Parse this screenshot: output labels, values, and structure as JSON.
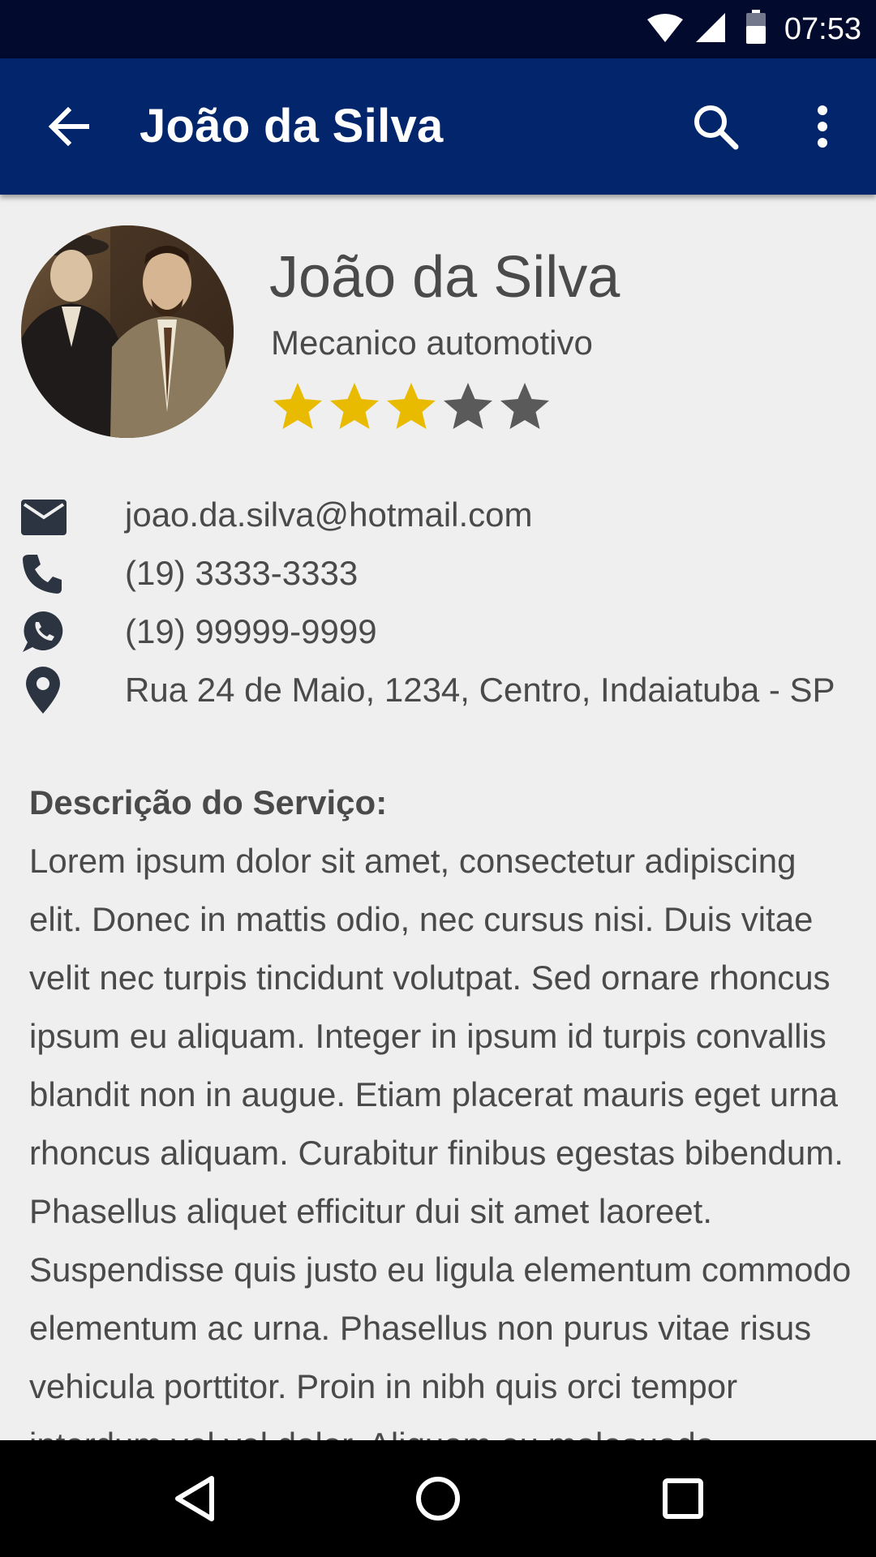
{
  "status_bar": {
    "time": "07:53",
    "icons": [
      "wifi-icon",
      "signal-icon",
      "battery-icon"
    ]
  },
  "app_bar": {
    "title": "João da Silva",
    "back_icon": "arrow-back-icon",
    "search_icon": "search-icon",
    "menu_icon": "more-vert-icon",
    "background_color": "#02256b"
  },
  "profile": {
    "name": "João da Silva",
    "occupation": "Mecanico automotivo",
    "rating": 3,
    "rating_max": 5,
    "star_color_filled": "#e9bb00",
    "star_color_empty": "#5a5a5a"
  },
  "contacts": [
    {
      "icon": "email-icon",
      "text": "joao.da.silva@hotmail.com"
    },
    {
      "icon": "phone-icon",
      "text": "(19) 3333-3333"
    },
    {
      "icon": "whatsapp-icon",
      "text": "(19) 99999-9999"
    },
    {
      "icon": "location-pin-icon",
      "text": "Rua 24 de Maio, 1234, Centro, Indaiatuba - SP"
    }
  ],
  "description": {
    "title": "Descrição do Serviço:",
    "body": "Lorem ipsum dolor sit amet, consectetur adipiscing elit. Donec in mattis odio, nec cursus nisi. Duis vitae velit nec turpis tincidunt volutpat. Sed ornare rhoncus ipsum eu aliquam. Integer in ipsum id turpis convallis blandit non in augue. Etiam placerat mauris eget urna rhoncus aliquam. Curabitur finibus egestas bibendum. Phasellus aliquet efficitur dui sit amet laoreet. Suspendisse quis justo eu ligula elementum commodo elementum ac urna. Phasellus non purus vitae risus vehicula porttitor. Proin in nibh quis orci tempor interdum vel vel dolor. Aliquam eu malesuada"
  },
  "nav_bar": {
    "buttons": [
      "back-triangle-icon",
      "home-circle-icon",
      "recents-square-icon"
    ]
  }
}
